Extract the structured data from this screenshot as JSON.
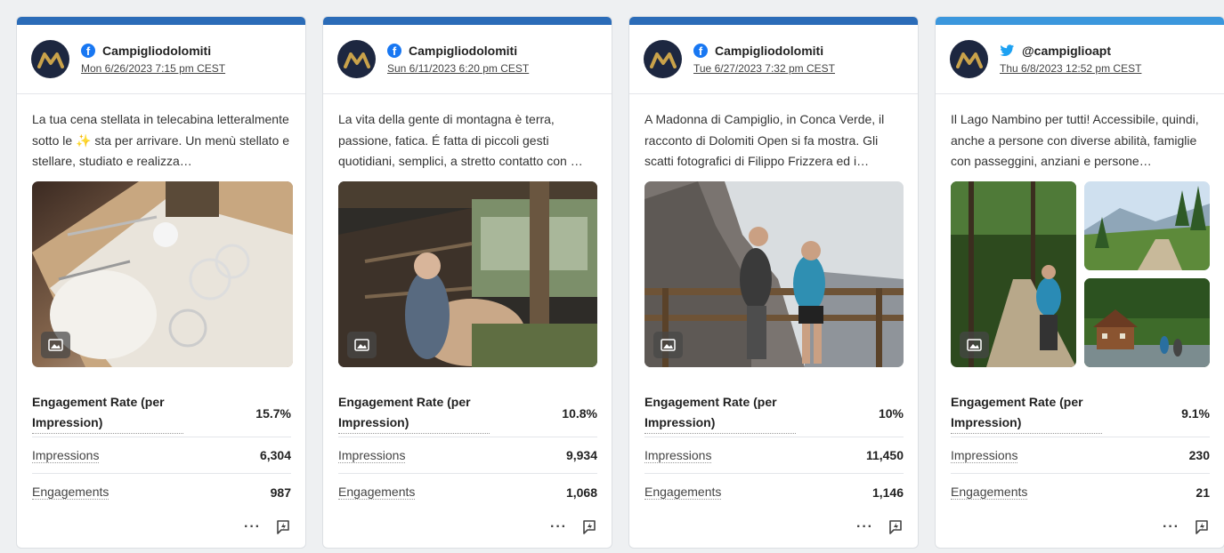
{
  "cards": [
    {
      "account": "Campigliodolomiti",
      "network": "facebook",
      "date": "Mon 6/26/2023 7:15 pm CEST",
      "text_before": "La tua cena stellata in telecabina letteralmente sotto le ",
      "emoji": "✨",
      "text_after": " sta per arrivare. Un menù stellato e stellare, studiato e realizza…",
      "metric_label": "Engagement Rate (per Impression)",
      "metric_value": "15.7%",
      "impressions_label": "Impressions",
      "impressions": "6,304",
      "engagements_label": "Engagements",
      "engagements": "987",
      "more": "···"
    },
    {
      "account": "Campigliodolomiti",
      "network": "facebook",
      "date": "Sun 6/11/2023 6:20 pm CEST",
      "text": "La vita della gente di montagna è terra, passione, fatica. É fatta di piccoli gesti quotidiani, semplici, a stretto contatto con …",
      "metric_label": "Engagement Rate (per Impression)",
      "metric_value": "10.8%",
      "impressions_label": "Impressions",
      "impressions": "9,934",
      "engagements_label": "Engagements",
      "engagements": "1,068",
      "more": "···"
    },
    {
      "account": "Campigliodolomiti",
      "network": "facebook",
      "date": "Tue 6/27/2023 7:32 pm CEST",
      "text": "A Madonna di Campiglio, in Conca Verde, il racconto di Dolomiti Open si fa mostra. Gli scatti fotografici di Filippo Frizzera ed i…",
      "metric_label": "Engagement Rate (per Impression)",
      "metric_value": "10%",
      "impressions_label": "Impressions",
      "impressions": "11,450",
      "engagements_label": "Engagements",
      "engagements": "1,146",
      "more": "···"
    },
    {
      "account": "@campiglioapt",
      "network": "twitter",
      "date": "Thu 6/8/2023 12:52 pm CEST",
      "text": "Il Lago Nambino per tutti! Accessibile, quindi, anche a persone con diverse abilità, famiglie con passeggini, anziani e persone…",
      "metric_label": "Engagement Rate (per Impression)",
      "metric_value": "9.1%",
      "impressions_label": "Impressions",
      "impressions": "230",
      "engagements_label": "Engagements",
      "engagements": "21",
      "more": "···"
    }
  ],
  "colors": {
    "facebook_bar": "#2b6cb8",
    "twitter_bar": "#3b97dd",
    "facebook_icon": "#1877f2",
    "twitter_icon": "#1da1f2",
    "avatar_bg": "#1d2740",
    "avatar_logo": "#c9a24a"
  },
  "icons": {
    "network_facebook": "facebook-icon",
    "network_twitter": "twitter-bird-icon",
    "image_badge": "image-icon",
    "boost": "boost-post-icon",
    "more": "more-options-icon"
  }
}
